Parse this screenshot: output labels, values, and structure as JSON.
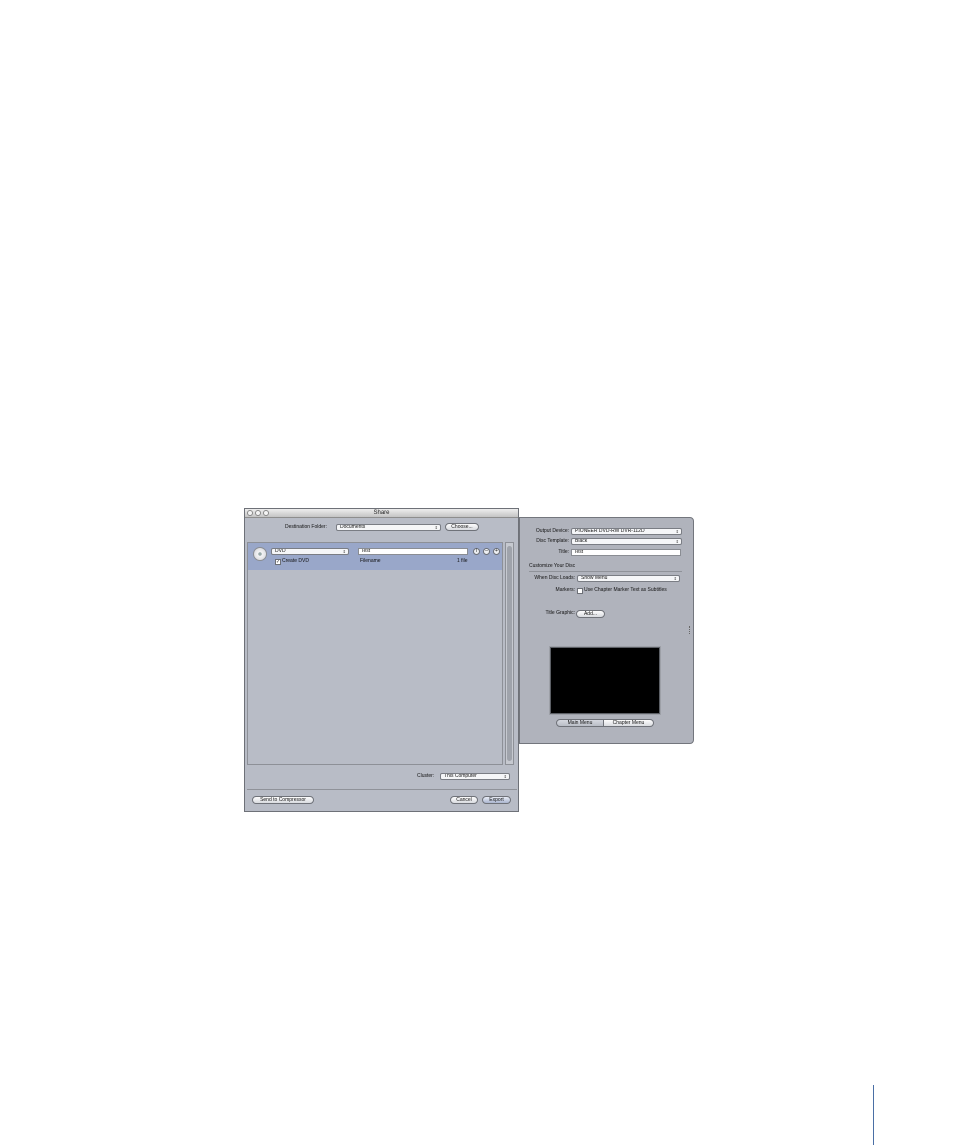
{
  "share": {
    "title": "Share",
    "destination_label": "Destination Folder:",
    "destination_value": "Documents",
    "choose_button": "Choose...",
    "row": {
      "type_value": "DVD",
      "name_value": "Test",
      "checkbox_mark": "✓",
      "checkbox_label": "Create DVD",
      "filename_label": "Filename",
      "file_count": "1 file",
      "info_symbol": "i",
      "remove_symbol": "–",
      "add_symbol": "+"
    },
    "cluster_label": "Cluster:",
    "cluster_value": "This Computer",
    "send_button": "Send to Compressor",
    "cancel_button": "Cancel",
    "export_button": "Export"
  },
  "drawer": {
    "output_device_label": "Output Device:",
    "output_device_value": "PIONEER DVD-RW DVR-112D",
    "disc_template_label": "Disc Template:",
    "disc_template_value": "Black",
    "title_label": "Title:",
    "title_value": "Test",
    "customize_heading": "Customize Your Disc",
    "when_disc_loads_label": "When Disc Loads:",
    "when_disc_loads_value": "Show Menu",
    "markers_label": "Markers:",
    "markers_option": "Use Chapter Marker Text as Subtitles",
    "title_graphic_label": "Title Graphic:",
    "add_button": "Add...",
    "main_menu_tab": "Main Menu",
    "chapter_menu_tab": "Chapter Menu"
  },
  "colors": {
    "window_bg": "#b8bcc6",
    "selection": "#99a7c9",
    "drawer_bg": "#b0b3bc",
    "preview_bg": "#000000"
  }
}
